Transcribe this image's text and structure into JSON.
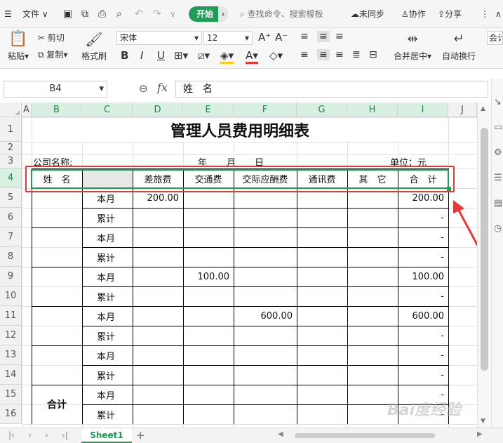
{
  "titlebar": {
    "menu_label": "文件",
    "start_label": "开始",
    "search_placeholder": "查找命令、搜索模板",
    "sync_label": "未同步",
    "collab_label": "协作",
    "share_label": "分享"
  },
  "ribbon": {
    "paste_label": "粘贴",
    "cut_label": "剪切",
    "copy_label": "复制",
    "format_painter_label": "格式刷",
    "font_name": "宋体",
    "font_size": "12",
    "bold": "B",
    "italic": "I",
    "underline": "U",
    "merge_label": "合并居中",
    "wrap_label": "自动换行",
    "partial_label": "会计"
  },
  "formula_bar": {
    "name_box": "B4",
    "fx_label": "fx",
    "content": "姓　名"
  },
  "columns": [
    "A",
    "B",
    "C",
    "D",
    "E",
    "F",
    "G",
    "H",
    "I",
    "J"
  ],
  "rows": [
    "1",
    "2",
    "3",
    "4",
    "5",
    "6",
    "7",
    "8",
    "9",
    "10",
    "11",
    "12",
    "13",
    "14",
    "15",
    "16"
  ],
  "sheet": {
    "title": "管理人员费用明细表",
    "company_label": "公司名称:",
    "year_label": "年",
    "month_label": "月",
    "day_label": "日",
    "unit_label": "单位：元",
    "headers": [
      "姓　名",
      "",
      "差旅费",
      "交通费",
      "交际应酬费",
      "通讯费",
      "其　它",
      "合　计"
    ],
    "body": [
      {
        "c": "本月",
        "d": "200.00",
        "e": "",
        "f": "",
        "i": "200.00"
      },
      {
        "c": "累计",
        "d": "",
        "e": "",
        "f": "",
        "i": "-"
      },
      {
        "c": "本月",
        "d": "",
        "e": "",
        "f": "",
        "i": "-"
      },
      {
        "c": "累计",
        "d": "",
        "e": "",
        "f": "",
        "i": "-"
      },
      {
        "c": "本月",
        "d": "",
        "e": "100.00",
        "f": "",
        "i": "100.00"
      },
      {
        "c": "累计",
        "d": "",
        "e": "",
        "f": "",
        "i": "-"
      },
      {
        "c": "本月",
        "d": "",
        "e": "",
        "f": "600.00",
        "i": "600.00"
      },
      {
        "c": "累计",
        "d": "",
        "e": "",
        "f": "",
        "i": "-"
      },
      {
        "c": "本月",
        "d": "",
        "e": "",
        "f": "",
        "i": "-"
      },
      {
        "c": "累计",
        "d": "",
        "e": "",
        "f": "",
        "i": "-"
      },
      {
        "c": "本月",
        "d": "",
        "e": "",
        "f": "",
        "i": "-"
      },
      {
        "c": "累计",
        "d": "",
        "e": "",
        "f": "",
        "i": "-"
      }
    ],
    "total_label": "合计"
  },
  "tabs": {
    "sheet1": "Sheet1",
    "add": "+"
  },
  "watermark": "Bai度经验",
  "colors": {
    "accent_green": "#1e9d57",
    "highlight_red": "#e53935"
  }
}
